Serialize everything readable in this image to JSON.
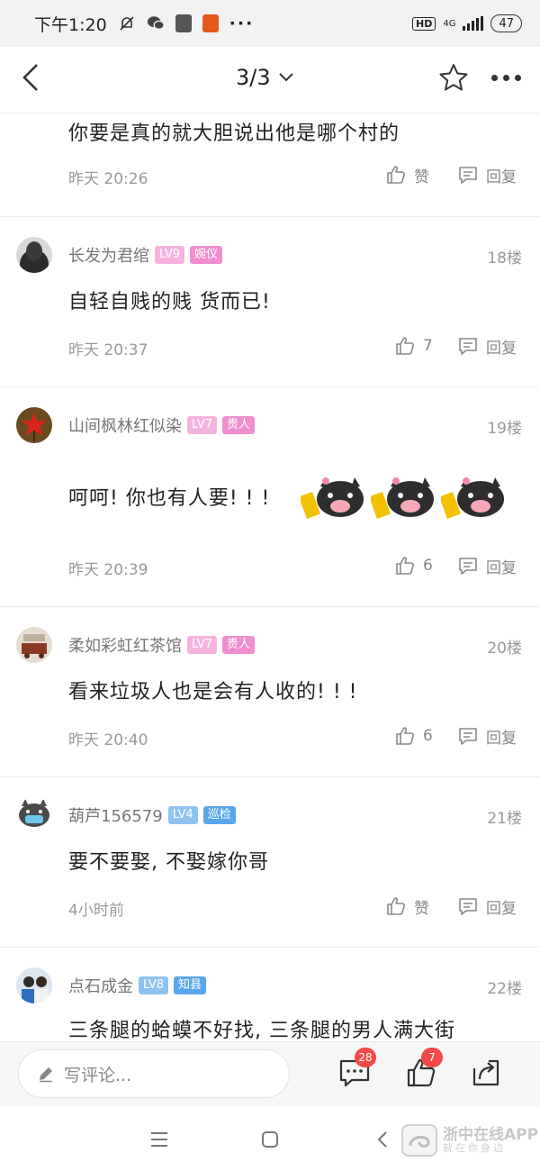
{
  "status_bar": {
    "time": "下午1:20",
    "network": "4G",
    "hd": "HD",
    "battery": "47"
  },
  "nav": {
    "page_indicator": "3/3"
  },
  "top_partial": {
    "content": "你要是真的就大胆说出他是哪个村的",
    "time": "昨天 20:26",
    "like_label": "赞",
    "reply_label": "回复"
  },
  "comments": [
    {
      "username": "长发为君绾",
      "level": "LV9",
      "rank": "婉仪",
      "floor": "18楼",
      "content": "自轻自贱的贱 货而已!",
      "time": "昨天 20:37",
      "likes": "7",
      "reply_label": "回复"
    },
    {
      "username": "山间枫林红似染",
      "level": "LV7",
      "rank": "贵人",
      "floor": "19楼",
      "content": "呵呵! 你也有人要! ! !",
      "time": "昨天 20:39",
      "likes": "6",
      "reply_label": "回复"
    },
    {
      "username": "柔如彩虹红茶馆",
      "level": "LV7",
      "rank": "贵人",
      "floor": "20楼",
      "content": "看来垃圾人也是会有人收的! ! !",
      "time": "昨天 20:40",
      "likes": "6",
      "reply_label": "回复"
    },
    {
      "username": "葫芦156579",
      "level": "LV4",
      "rank": "巡检",
      "floor": "21楼",
      "content": "要不要娶, 不娶嫁你哥",
      "time": "4小时前",
      "likes": "赞",
      "reply_label": "回复"
    },
    {
      "username": "点石成金",
      "level": "LV8",
      "rank": "知县",
      "floor": "22楼",
      "content": "三条腿的蛤蟆不好找, 三条腿的男人满大街"
    }
  ],
  "bottom_bar": {
    "placeholder": "写评论...",
    "comment_count": "28",
    "like_count": "7"
  },
  "watermark": {
    "title": "浙中在线APP",
    "subtitle": "就在你身边"
  },
  "colors": {
    "level_pink": "#f4b3dc",
    "level_blue": "#8fc3ef",
    "rank_pink": "#ef8fcf",
    "rank_blue": "#5aa6ea",
    "badge_red": "#f24a4a"
  }
}
